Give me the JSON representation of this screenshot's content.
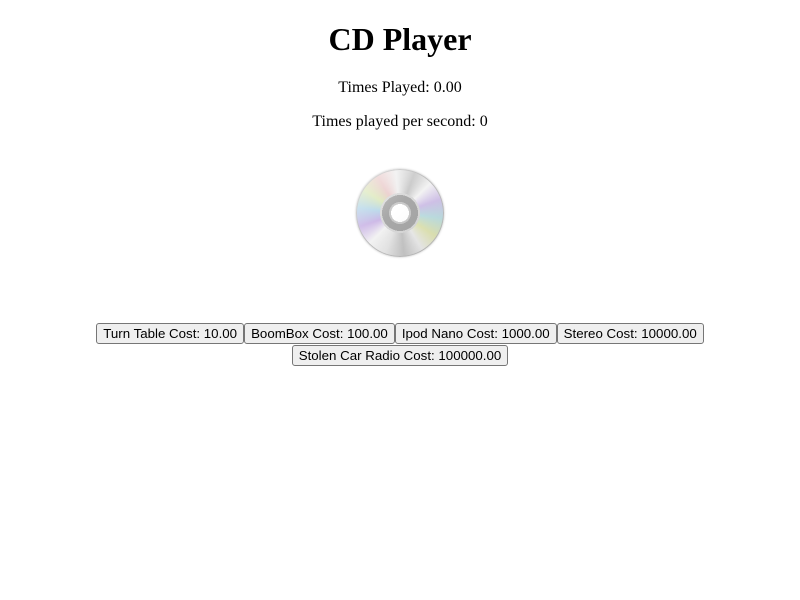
{
  "page": {
    "title": "CD Player"
  },
  "stats": {
    "times_played_label": "Times Played:",
    "times_played_value": "0.00",
    "per_second_label": "Times played per second:",
    "per_second_value": "0"
  },
  "cd": {
    "icon": "cd-disc-icon"
  },
  "shop": {
    "items": [
      {
        "label": "Turn Table Cost: 10.00"
      },
      {
        "label": "BoomBox Cost: 100.00"
      },
      {
        "label": "Ipod Nano Cost: 1000.00"
      },
      {
        "label": "Stereo Cost: 10000.00"
      },
      {
        "label": "Stolen Car Radio Cost: 100000.00"
      }
    ]
  }
}
